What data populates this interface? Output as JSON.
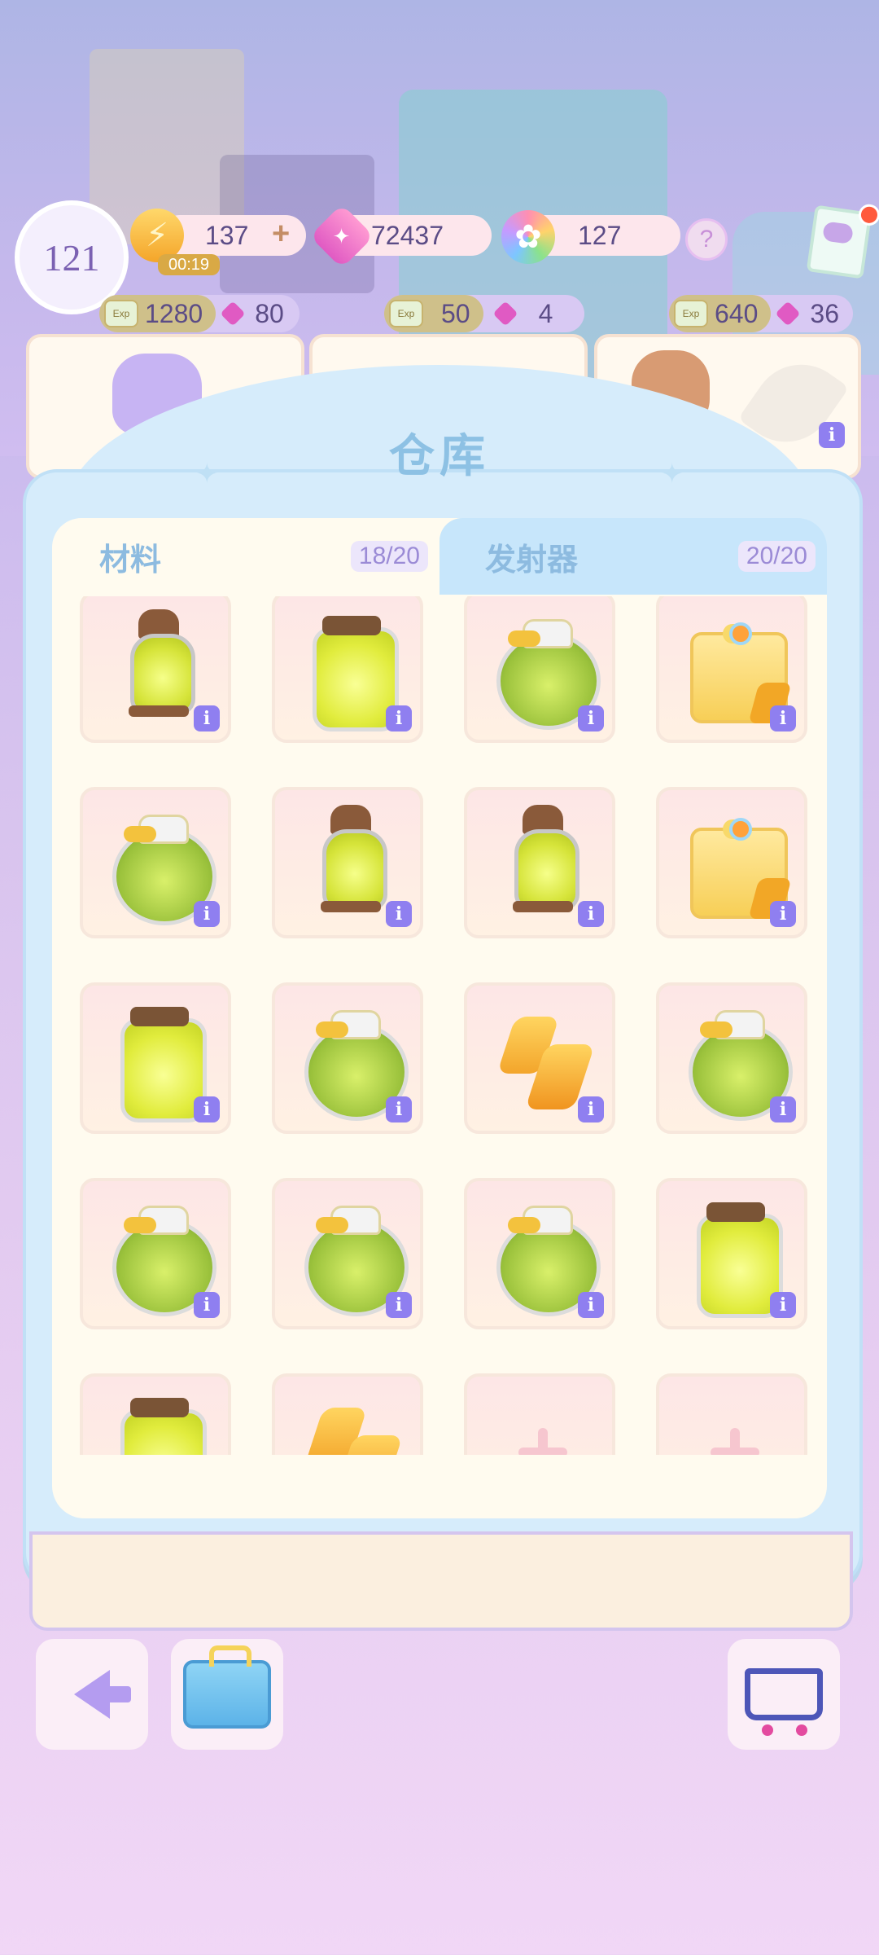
{
  "top_bar": {
    "level": "121",
    "energy": "137",
    "energy_timer": "00:19",
    "energy_add": "+",
    "gems": "72437",
    "stars": "127",
    "help": "?"
  },
  "rewards": [
    {
      "exp_label": "Exp",
      "exp": "1280",
      "gems": "80"
    },
    {
      "exp_label": "Exp",
      "exp": "50",
      "gems": "4"
    },
    {
      "exp_label": "Exp",
      "exp": "640",
      "gems": "36"
    }
  ],
  "warehouse": {
    "title": "仓库",
    "tabs": [
      {
        "label": "材料",
        "count": "18/20"
      },
      {
        "label": "发射器",
        "count": "20/20"
      }
    ],
    "info_glyph": "i",
    "items": [
      "lantern-icon",
      "jar-icon",
      "bag-icon",
      "gift-box-icon",
      "bag-icon",
      "lantern-icon",
      "lantern-icon",
      "gift-box-icon",
      "jar-icon",
      "bag-icon",
      "lightning-bolts-icon",
      "bag-icon",
      "bag-icon",
      "bag-icon",
      "bag-icon",
      "jar-icon",
      "jar-icon",
      "lightning-bolts-icon",
      "empty-slot",
      "empty-slot"
    ]
  },
  "colors": {
    "panel": "#d6ecfb",
    "tab_active_text": "#8dbbe0",
    "info_badge": "#8f7ff0",
    "count_text": "#9b8bd6"
  }
}
